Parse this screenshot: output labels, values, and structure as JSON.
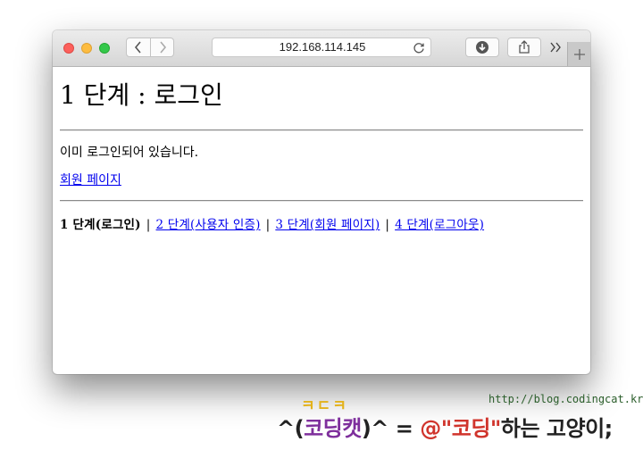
{
  "browser": {
    "url": "192.168.114.145",
    "icons": {
      "back": "chevron-left-icon",
      "forward": "chevron-right-icon",
      "reload": "reload-icon",
      "download": "download-icon",
      "share": "share-icon",
      "more": "double-chevron-right-icon",
      "new_tab": "plus-icon"
    }
  },
  "page": {
    "title": "1 단계 : 로그인",
    "message": "이미 로그인되어 있습니다.",
    "member_link": "회원 페이지",
    "steps": {
      "current": "1 단계(로그인)",
      "separator": "|",
      "step2": "2 단계(사용자 인증)",
      "step3": "3 단계(회원 페이지)",
      "step4": "4 단계(로그아웃)"
    }
  },
  "footer": {
    "url": "http://blog.codingcat.kr/",
    "logo_top": "ㅋㄷㅋ",
    "slogan_prefix": "^(",
    "slogan_brand": "코딩캣",
    "slogan_mid": ")^ = ",
    "slogan_at": "@\"코딩\"",
    "slogan_suffix": "하는 고양이;"
  },
  "colors": {
    "link": "#0000ee",
    "close_button": "#fc605c",
    "minimize_button": "#fdbc40",
    "zoom_button": "#34c84a"
  }
}
